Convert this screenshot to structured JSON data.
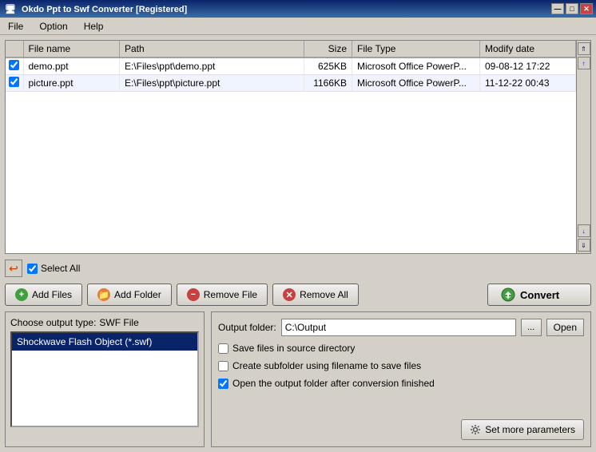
{
  "titleBar": {
    "title": "Okdo Ppt to Swf Converter [Registered]",
    "buttons": {
      "minimize": "—",
      "maximize": "□",
      "close": "✕"
    }
  },
  "menuBar": {
    "items": [
      "File",
      "Option",
      "Help"
    ]
  },
  "fileTable": {
    "headers": [
      "File name",
      "Path",
      "Size",
      "File Type",
      "Modify date"
    ],
    "rows": [
      {
        "checked": true,
        "name": "demo.ppt",
        "path": "E:\\Files\\ppt\\demo.ppt",
        "size": "625KB",
        "type": "Microsoft Office PowerP...",
        "modified": "09-08-12 17:22"
      },
      {
        "checked": true,
        "name": "picture.ppt",
        "path": "E:\\Files\\ppt\\picture.ppt",
        "size": "1166KB",
        "type": "Microsoft Office PowerP...",
        "modified": "11-12-22 00:43"
      }
    ]
  },
  "controls": {
    "selectAll": "Select All",
    "buttons": {
      "addFiles": "Add Files",
      "addFolder": "Add Folder",
      "removeFile": "Remove File",
      "removeAll": "Remove All",
      "convert": "Convert"
    }
  },
  "outputType": {
    "label": "Choose output type:",
    "value": "SWF File",
    "formats": [
      "Shockwave Flash Object (*.swf)"
    ]
  },
  "outputSettings": {
    "folderLabel": "Output folder:",
    "folderValue": "C:\\Output",
    "browseBtnLabel": "...",
    "openBtnLabel": "Open",
    "checkboxes": [
      {
        "checked": false,
        "label": "Save files in source directory"
      },
      {
        "checked": false,
        "label": "Create subfolder using filename to save files"
      },
      {
        "checked": true,
        "label": "Open the output folder after conversion finished"
      }
    ],
    "paramsBtn": "Set more parameters"
  }
}
